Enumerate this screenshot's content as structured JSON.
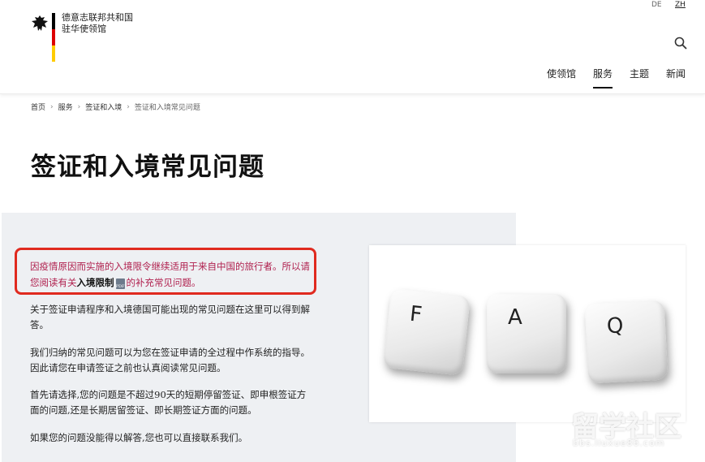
{
  "header": {
    "logo_line1": "德意志联邦共和国",
    "logo_line2": "驻华使领馆",
    "lang_de": "DE",
    "lang_zh": "ZH",
    "nav": [
      "使领馆",
      "服务",
      "主题",
      "新闻"
    ],
    "flag_colors": [
      "#000000",
      "#dd0000",
      "#ffcc00"
    ]
  },
  "breadcrumb": {
    "items": [
      "首页",
      "服务",
      "签证和入境"
    ],
    "current": "签证和入境常见问题"
  },
  "page_title": "签证和入境常见问题",
  "notice": {
    "text_before": "因疫情原因而实施的入境限令继续适用于来自中国的旅行者。所以请您阅读有关",
    "link": "入境限制",
    "pdf_label": "PDF",
    "text_after": "的补充常见问题。",
    "color": "#b0204e",
    "border_color": "#e02a1f"
  },
  "paragraphs": [
    "关于签证申请程序和入境德国可能出现的常见问题在这里可以得到解答。",
    "我们归纳的常见问题可以为您在签证申请的全过程中作系统的指导。因此请您在申请签证之前也认真阅读常见问题。",
    "首先请选择,您的问题是不超过90天的短期停留签证、即申根签证方面的问题,还是长期居留签证、即长期签证方面的问题。",
    "如果您的问题没能得以解答,您也可以直接联系我们。"
  ],
  "faq_keys": [
    "F",
    "A",
    "Q"
  ],
  "watermark": {
    "main": "留学社区",
    "sub": "bbs.liuxue86.com"
  }
}
